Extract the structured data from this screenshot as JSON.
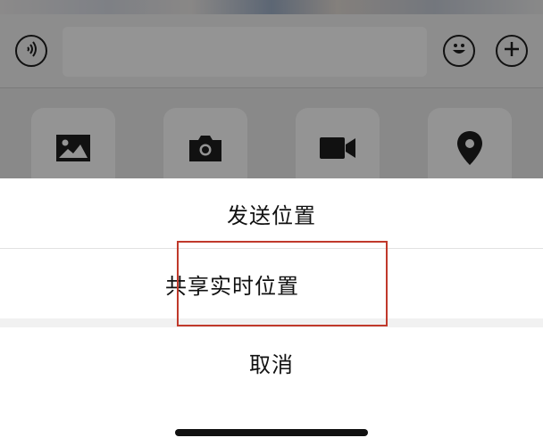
{
  "sheet": {
    "send_location": "发送位置",
    "share_live_location": "共享实时位置",
    "cancel": "取消"
  },
  "icons": {
    "voice": "voice-icon",
    "emoji": "emoji-icon",
    "plus": "plus-icon",
    "photo": "photo-icon",
    "camera": "camera-icon",
    "video": "video-call-icon",
    "location": "location-pin-icon"
  },
  "colors": {
    "highlight": "#c0392b",
    "overlay": "rgba(0,0,0,0.42)",
    "icon": "#1e1e1e"
  }
}
